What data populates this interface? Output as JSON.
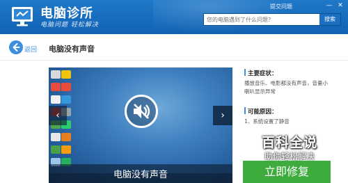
{
  "header": {
    "app_title": "电脑诊所",
    "slogan": "电脑问题 轻松解决",
    "ask_link": "提交问题",
    "minimize_glyph": "—",
    "close_glyph": "✕",
    "search_placeholder": "您的电脑遇到了什么问题？",
    "search_button": "搜索"
  },
  "subheader": {
    "back_label": "返回",
    "page_title": "电脑没有声音"
  },
  "video": {
    "caption": "电脑没有声音",
    "prev_glyph": "‹",
    "next_glyph": "›"
  },
  "info": {
    "symptom_title": "主要症状：",
    "symptom_text": [
      "播放音乐、电影都没有声音，音量小",
      "喇叭显示异常"
    ],
    "cause_title": "可能原因：",
    "cause_text": "1、系统设置了静音"
  },
  "watermark": {
    "main": "百科全说",
    "sub": "助你轻松解决"
  },
  "actions": {
    "fix_button": "立即修复"
  },
  "colors": {
    "header_blue": "#1a6fc1",
    "accent_blue": "#3d8ede",
    "fix_green": "#3dac3d"
  }
}
